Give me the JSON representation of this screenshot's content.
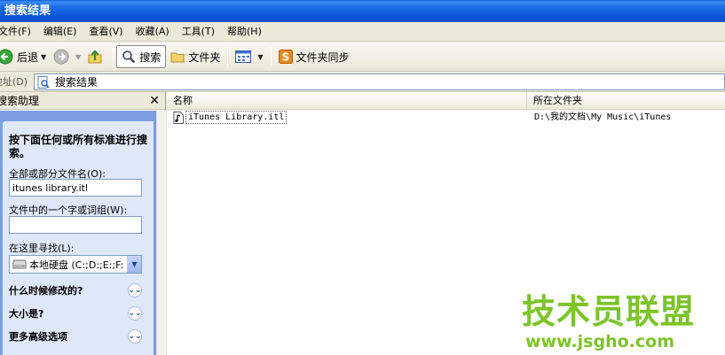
{
  "window": {
    "title": "搜索结果"
  },
  "menu": [
    "文件(F)",
    "编辑(E)",
    "查看(V)",
    "收藏(A)",
    "工具(T)",
    "帮助(H)"
  ],
  "toolbar": {
    "back_label": "后退",
    "search_label": "搜索",
    "folders_label": "文件夹",
    "sync_label": "文件夹同步"
  },
  "address": {
    "label": "地址(D)",
    "value": "搜索结果"
  },
  "search_pane": {
    "title": "搜索助理",
    "hint": "按下面任何或所有标准进行搜索。",
    "name_label": "全部或部分文件名(O):",
    "name_value": "itunes library.itl",
    "word_label": "文件中的一个字或词组(W):",
    "word_value": "",
    "look_in_label": "在这里寻找(L):",
    "look_in_value": "本地硬盘 (C:;D:;E:;F:",
    "options": [
      "什么时候修改的?",
      "大小是?",
      "更多高级选项"
    ]
  },
  "results": {
    "columns": [
      "名称",
      "所在文件夹"
    ],
    "rows": [
      {
        "name": "iTunes Library.itl",
        "folder": "D:\\我的文档\\My Music\\iTunes"
      }
    ]
  },
  "watermark": {
    "title": "技术员联盟",
    "url": "www.jsgho.com"
  },
  "colors": {
    "title_bar": "#0b55d6",
    "pane_blue": "#7b9ee3",
    "card": "#dfe8f9",
    "watermark": "#7cc42a"
  }
}
